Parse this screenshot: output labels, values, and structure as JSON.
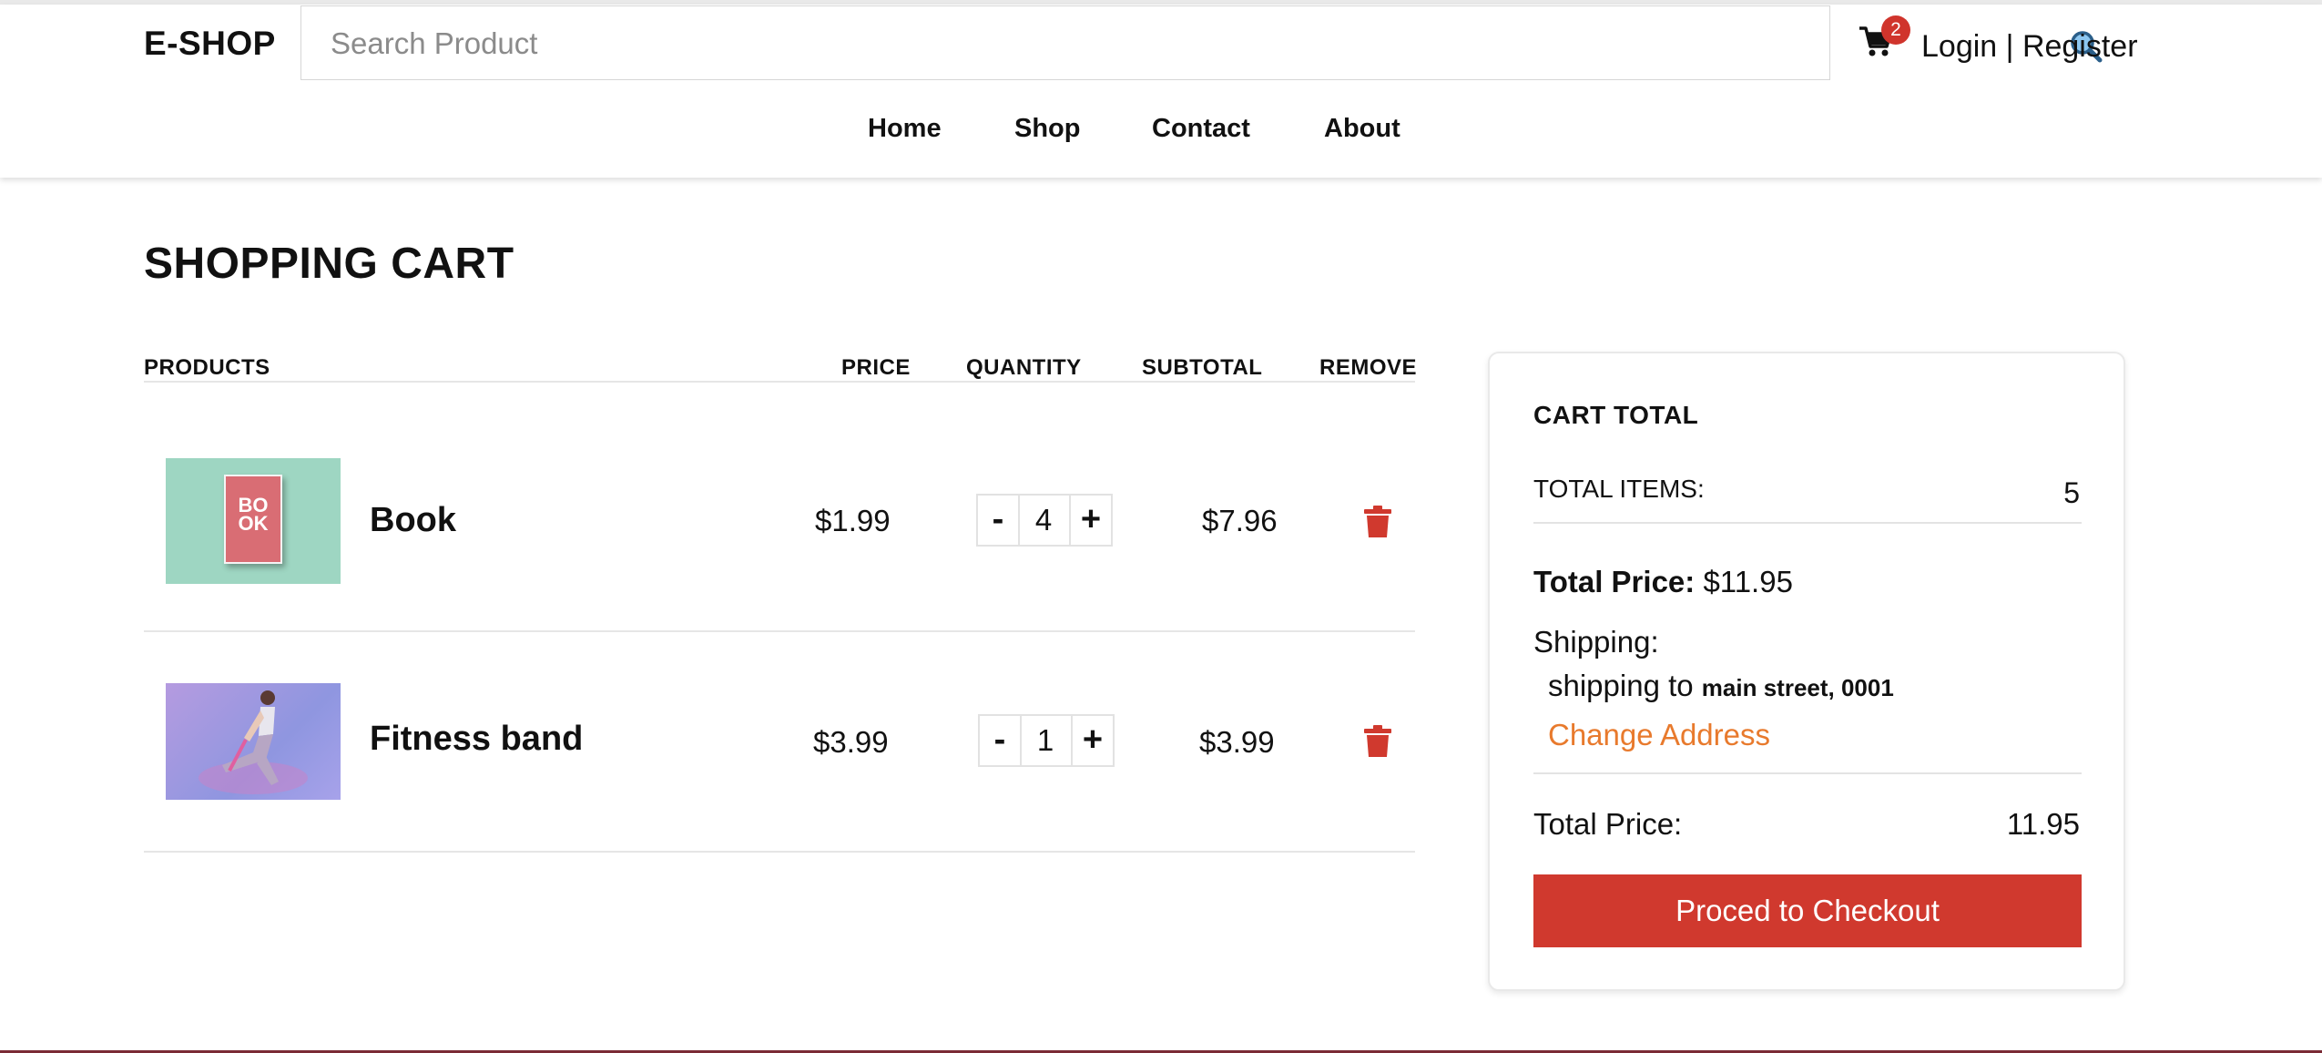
{
  "header": {
    "logo": "E-SHOP",
    "search_placeholder": "Search Product",
    "search_icon": "magnifier-icon",
    "cart_icon": "cart-icon",
    "cart_count": "2",
    "login_label": "Login",
    "divider": " | ",
    "register_label": "Register",
    "nav": [
      "Home",
      "Shop",
      "Contact",
      "About"
    ]
  },
  "page": {
    "title": "SHOPPING CART",
    "columns": [
      "PRODUCTS",
      "PRICE",
      "QUANTITY",
      "SUBTOTAL",
      "REMOVE"
    ]
  },
  "cart_items": [
    {
      "name": "Book",
      "price": "$1.99",
      "quantity": "4",
      "subtotal": "$7.96",
      "thumb_text_1": "BO",
      "thumb_text_2": "OK"
    },
    {
      "name": "Fitness band",
      "price": "$3.99",
      "quantity": "1",
      "subtotal": "$3.99"
    }
  ],
  "qty_controls": {
    "minus": "-",
    "plus": "+"
  },
  "totals": {
    "heading": "CART TOTAL",
    "items_label": "TOTAL ITEMS:",
    "items_value": "5",
    "price_label": "Total Price:",
    "price_value": "$11.95",
    "shipping_label": "Shipping:",
    "shipping_prefix": "shipping to",
    "shipping_address": "main street, 0001",
    "change_address": "Change Address",
    "final_label": "Total Price:",
    "final_value": "11.95",
    "checkout_label": "Proced to Checkout"
  },
  "colors": {
    "accent_red": "#d0392e",
    "link_orange": "#e87a2d",
    "book_thumb_bg": "#9ed6c2",
    "band_thumb_bg": "#8f96e0"
  }
}
